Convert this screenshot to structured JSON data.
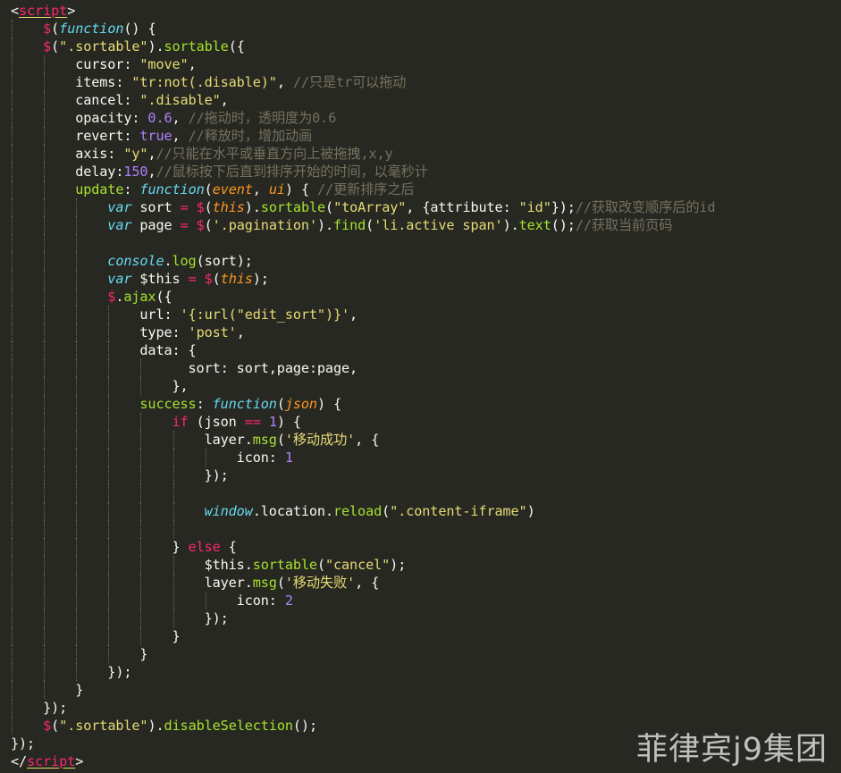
{
  "editor": {
    "theme_colors": {
      "background": "#272822",
      "foreground": "#f8f8f2",
      "keyword": "#f92672",
      "string": "#e6db74",
      "number": "#ae81ff",
      "function": "#66d9ef",
      "name": "#a6e22e",
      "parameter": "#fd971f",
      "comment": "#75715e"
    },
    "lines": [
      {
        "indent": 0,
        "tokens": [
          [
            "pun",
            "<"
          ],
          [
            "tag",
            "script"
          ],
          [
            "pun",
            ">"
          ]
        ]
      },
      {
        "indent": 1,
        "tokens": [
          [
            "kw",
            "$"
          ],
          [
            "pun",
            "("
          ],
          [
            "fn",
            "function"
          ],
          [
            "pun",
            "() {"
          ]
        ]
      },
      {
        "indent": 1,
        "tokens": [
          [
            "kw",
            "$"
          ],
          [
            "pun",
            "("
          ],
          [
            "str",
            "\".sortable\""
          ],
          [
            "pun",
            ")."
          ],
          [
            "nm",
            "sortable"
          ],
          [
            "pun",
            "({"
          ]
        ]
      },
      {
        "indent": 2,
        "tokens": [
          [
            "pl",
            "cursor: "
          ],
          [
            "str",
            "\"move\""
          ],
          [
            "pun",
            ","
          ]
        ]
      },
      {
        "indent": 2,
        "tokens": [
          [
            "pl",
            "items: "
          ],
          [
            "str",
            "\"tr:not(.disable)\""
          ],
          [
            "pun",
            ", "
          ],
          [
            "com",
            "//只是tr可以拖动"
          ]
        ]
      },
      {
        "indent": 2,
        "tokens": [
          [
            "pl",
            "cancel: "
          ],
          [
            "str",
            "\".disable\""
          ],
          [
            "pun",
            ","
          ]
        ]
      },
      {
        "indent": 2,
        "tokens": [
          [
            "pl",
            "opacity: "
          ],
          [
            "num",
            "0.6"
          ],
          [
            "pun",
            ", "
          ],
          [
            "com",
            "//拖动时，透明度为0.6"
          ]
        ]
      },
      {
        "indent": 2,
        "tokens": [
          [
            "pl",
            "revert: "
          ],
          [
            "num",
            "true"
          ],
          [
            "pun",
            ", "
          ],
          [
            "com",
            "//释放时，增加动画"
          ]
        ]
      },
      {
        "indent": 2,
        "tokens": [
          [
            "pl",
            "axis: "
          ],
          [
            "str",
            "\"y\""
          ],
          [
            "pun",
            ","
          ],
          [
            "com",
            "//只能在水平或垂直方向上被拖拽,x,y"
          ]
        ]
      },
      {
        "indent": 2,
        "tokens": [
          [
            "pl",
            "delay:"
          ],
          [
            "num",
            "150"
          ],
          [
            "pun",
            ","
          ],
          [
            "com",
            "//鼠标按下后直到排序开始的时间，以毫秒计"
          ]
        ]
      },
      {
        "indent": 2,
        "tokens": [
          [
            "nm",
            "update"
          ],
          [
            "pun",
            ": "
          ],
          [
            "fn",
            "function"
          ],
          [
            "pun",
            "("
          ],
          [
            "par",
            "event"
          ],
          [
            "pun",
            ", "
          ],
          [
            "par",
            "ui"
          ],
          [
            "pun",
            ") { "
          ],
          [
            "com",
            "//更新排序之后"
          ]
        ]
      },
      {
        "indent": 3,
        "tokens": [
          [
            "fn",
            "var"
          ],
          [
            "pl",
            " sort "
          ],
          [
            "kw",
            "="
          ],
          [
            "pl",
            " "
          ],
          [
            "kw",
            "$"
          ],
          [
            "pun",
            "("
          ],
          [
            "par",
            "this"
          ],
          [
            "pun",
            ")."
          ],
          [
            "nm",
            "sortable"
          ],
          [
            "pun",
            "("
          ],
          [
            "str",
            "\"toArray\""
          ],
          [
            "pun",
            ", {attribute: "
          ],
          [
            "str",
            "\"id\""
          ],
          [
            "pun",
            "});"
          ],
          [
            "com",
            "//获取改变顺序后的id"
          ]
        ]
      },
      {
        "indent": 3,
        "tokens": [
          [
            "fn",
            "var"
          ],
          [
            "pl",
            " page "
          ],
          [
            "kw",
            "="
          ],
          [
            "pl",
            " "
          ],
          [
            "kw",
            "$"
          ],
          [
            "pun",
            "("
          ],
          [
            "str",
            "'.pagination'"
          ],
          [
            "pun",
            ")."
          ],
          [
            "nm",
            "find"
          ],
          [
            "pun",
            "("
          ],
          [
            "str",
            "'li.active span'"
          ],
          [
            "pun",
            ")."
          ],
          [
            "nm",
            "text"
          ],
          [
            "pun",
            "();"
          ],
          [
            "com",
            "//获取当前页码"
          ]
        ]
      },
      {
        "indent": 3,
        "tokens": []
      },
      {
        "indent": 3,
        "tokens": [
          [
            "fn",
            "console"
          ],
          [
            "pun",
            "."
          ],
          [
            "nm",
            "log"
          ],
          [
            "pun",
            "(sort);"
          ]
        ]
      },
      {
        "indent": 3,
        "tokens": [
          [
            "fn",
            "var"
          ],
          [
            "pl",
            " $this "
          ],
          [
            "kw",
            "="
          ],
          [
            "pl",
            " "
          ],
          [
            "kw",
            "$"
          ],
          [
            "pun",
            "("
          ],
          [
            "par",
            "this"
          ],
          [
            "pun",
            ");"
          ]
        ]
      },
      {
        "indent": 3,
        "tokens": [
          [
            "kw",
            "$"
          ],
          [
            "pun",
            "."
          ],
          [
            "nm",
            "ajax"
          ],
          [
            "pun",
            "({"
          ]
        ]
      },
      {
        "indent": 4,
        "tokens": [
          [
            "pl",
            "url: "
          ],
          [
            "str",
            "'{:url(\"edit_sort\")}'"
          ],
          [
            "pun",
            ","
          ]
        ]
      },
      {
        "indent": 4,
        "tokens": [
          [
            "pl",
            "type: "
          ],
          [
            "str",
            "'post'"
          ],
          [
            "pun",
            ","
          ]
        ]
      },
      {
        "indent": 4,
        "tokens": [
          [
            "pl",
            "data: {"
          ]
        ]
      },
      {
        "indent": 5,
        "pad": "  ",
        "tokens": [
          [
            "pl",
            "sort: sort,page:page,"
          ]
        ]
      },
      {
        "indent": 5,
        "tokens": [
          [
            "pun",
            "},"
          ]
        ]
      },
      {
        "indent": 4,
        "tokens": [
          [
            "nm",
            "success"
          ],
          [
            "pun",
            ": "
          ],
          [
            "fn",
            "function"
          ],
          [
            "pun",
            "("
          ],
          [
            "par",
            "json"
          ],
          [
            "pun",
            ") {"
          ]
        ]
      },
      {
        "indent": 5,
        "tokens": [
          [
            "kw",
            "if"
          ],
          [
            "pun",
            " (json "
          ],
          [
            "kw",
            "=="
          ],
          [
            "pun",
            " "
          ],
          [
            "num",
            "1"
          ],
          [
            "pun",
            ") {"
          ]
        ]
      },
      {
        "indent": 6,
        "tokens": [
          [
            "pl",
            "layer."
          ],
          [
            "nm",
            "msg"
          ],
          [
            "pun",
            "("
          ],
          [
            "str",
            "'移动成功'"
          ],
          [
            "pun",
            ", {"
          ]
        ]
      },
      {
        "indent": 7,
        "tokens": [
          [
            "pl",
            "icon: "
          ],
          [
            "num",
            "1"
          ]
        ]
      },
      {
        "indent": 6,
        "tokens": [
          [
            "pun",
            "});"
          ]
        ]
      },
      {
        "indent": 6,
        "tokens": []
      },
      {
        "indent": 6,
        "tokens": [
          [
            "fn",
            "window"
          ],
          [
            "pun",
            "."
          ],
          [
            "pl",
            "location."
          ],
          [
            "nm",
            "reload"
          ],
          [
            "pun",
            "("
          ],
          [
            "str",
            "\".content-iframe\""
          ],
          [
            "pun",
            ")"
          ]
        ]
      },
      {
        "indent": 6,
        "tokens": []
      },
      {
        "indent": 5,
        "tokens": [
          [
            "pun",
            "} "
          ],
          [
            "kw",
            "else"
          ],
          [
            "pun",
            " {"
          ]
        ]
      },
      {
        "indent": 6,
        "tokens": [
          [
            "pl",
            "$this."
          ],
          [
            "nm",
            "sortable"
          ],
          [
            "pun",
            "("
          ],
          [
            "str",
            "\"cancel\""
          ],
          [
            "pun",
            ");"
          ]
        ]
      },
      {
        "indent": 6,
        "tokens": [
          [
            "pl",
            "layer."
          ],
          [
            "nm",
            "msg"
          ],
          [
            "pun",
            "("
          ],
          [
            "str",
            "'移动失败'"
          ],
          [
            "pun",
            ", {"
          ]
        ]
      },
      {
        "indent": 7,
        "tokens": [
          [
            "pl",
            "icon: "
          ],
          [
            "num",
            "2"
          ]
        ]
      },
      {
        "indent": 6,
        "tokens": [
          [
            "pun",
            "});"
          ]
        ]
      },
      {
        "indent": 5,
        "tokens": [
          [
            "pun",
            "}"
          ]
        ]
      },
      {
        "indent": 4,
        "tokens": [
          [
            "pun",
            "}"
          ]
        ]
      },
      {
        "indent": 3,
        "tokens": [
          [
            "pun",
            "});"
          ]
        ]
      },
      {
        "indent": 2,
        "tokens": [
          [
            "pun",
            "}"
          ]
        ]
      },
      {
        "indent": 1,
        "tokens": [
          [
            "pun",
            "});"
          ]
        ]
      },
      {
        "indent": 1,
        "tokens": [
          [
            "kw",
            "$"
          ],
          [
            "pun",
            "("
          ],
          [
            "str",
            "\".sortable\""
          ],
          [
            "pun",
            ")."
          ],
          [
            "nm",
            "disableSelection"
          ],
          [
            "pun",
            "();"
          ]
        ]
      },
      {
        "indent": 0,
        "tokens": [
          [
            "pun",
            "});"
          ]
        ]
      },
      {
        "indent": 0,
        "tokens": [
          [
            "pun",
            "</"
          ],
          [
            "tag",
            "script"
          ],
          [
            "pun",
            ">"
          ]
        ]
      }
    ]
  },
  "watermark": {
    "text": "菲律宾j9集团"
  }
}
